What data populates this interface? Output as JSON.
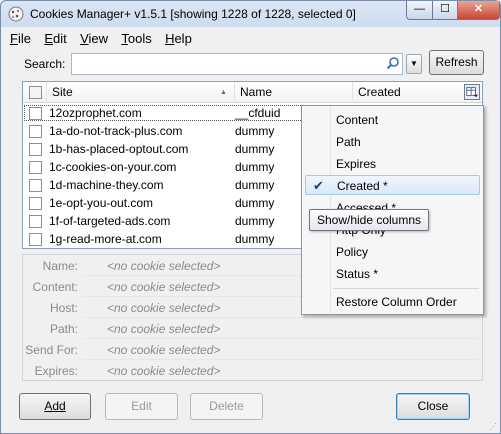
{
  "window": {
    "title": "Cookies Manager+ v1.5.1 [showing 1228 of 1228, selected 0]",
    "controls": {
      "minimize": "—",
      "maximize": "☐",
      "close": "✕"
    }
  },
  "menu": [
    {
      "label": "File",
      "key": "F",
      "rest": "ile"
    },
    {
      "label": "Edit",
      "key": "E",
      "rest": "dit"
    },
    {
      "label": "View",
      "key": "V",
      "rest": "iew"
    },
    {
      "label": "Tools",
      "key": "T",
      "rest": "ools"
    },
    {
      "label": "Help",
      "key": "H",
      "rest": "elp"
    }
  ],
  "search": {
    "label": "Search:",
    "value": "",
    "refresh_label": "Refresh"
  },
  "table": {
    "columns": {
      "site": "Site",
      "name": "Name",
      "created": "Created"
    },
    "rows": [
      {
        "site": "12ozprophet.com",
        "name": "__cfduid"
      },
      {
        "site": "1a-do-not-track-plus.com",
        "name": "dummy"
      },
      {
        "site": "1b-has-placed-optout.com",
        "name": "dummy"
      },
      {
        "site": "1c-cookies-on-your.com",
        "name": "dummy"
      },
      {
        "site": "1d-machine-they.com",
        "name": "dummy"
      },
      {
        "site": "1e-opt-you-out.com",
        "name": "dummy"
      },
      {
        "site": "1f-of-targeted-ads.com",
        "name": "dummy"
      },
      {
        "site": "1g-read-more-at.com",
        "name": "dummy"
      }
    ]
  },
  "details": {
    "empty_value": "<no cookie selected>",
    "fields": [
      "Name:",
      "Content:",
      "Host:",
      "Path:",
      "Send For:",
      "Expires:"
    ]
  },
  "column_menu": {
    "items": [
      {
        "label": "Content",
        "checked": false
      },
      {
        "label": "Path",
        "checked": false
      },
      {
        "label": "Expires",
        "checked": false
      },
      {
        "label": "Created *",
        "checked": true
      },
      {
        "label": "Accessed *",
        "checked": false
      },
      {
        "label": "Http Only",
        "checked": false
      },
      {
        "label": "Policy",
        "checked": false
      },
      {
        "label": "Status *",
        "checked": false
      }
    ],
    "restore_label": "Restore Column Order"
  },
  "tooltip": "Show/hide columns",
  "buttons": {
    "add": "Add",
    "edit": "Edit",
    "delete": "Delete",
    "close": "Close"
  }
}
